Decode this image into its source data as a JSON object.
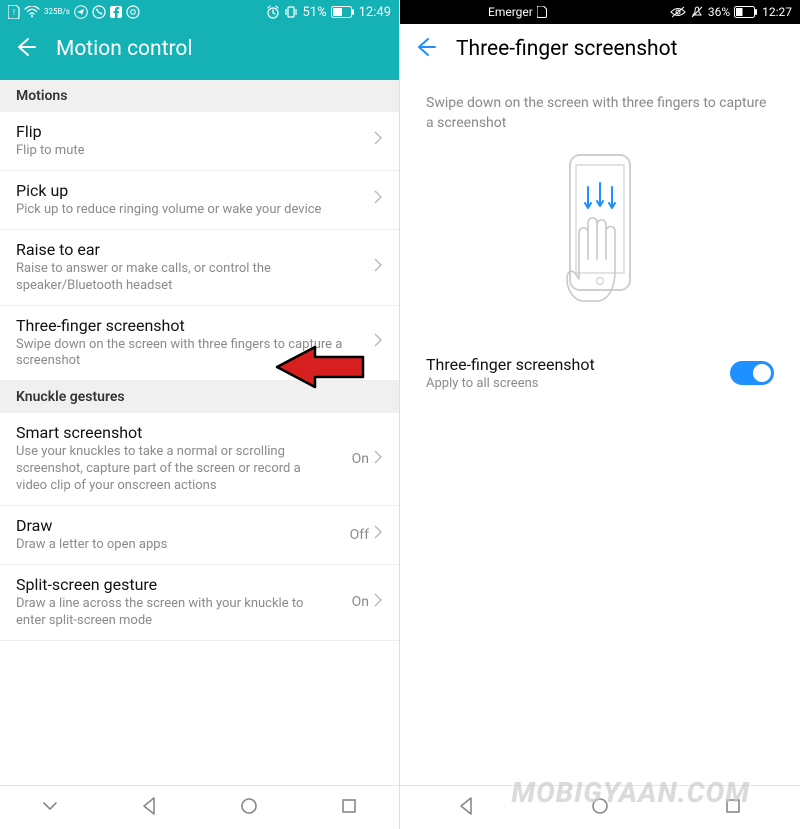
{
  "watermark": "MOBIGYAAN.COM",
  "left": {
    "statusbar": {
      "speed1": "325",
      "speed2": "B/s",
      "battery_pct": "51%",
      "time": "12:49"
    },
    "header": {
      "title": "Motion control"
    },
    "sections": {
      "motions": "Motions",
      "knuckle": "Knuckle gestures"
    },
    "rows": {
      "flip": {
        "title": "Flip",
        "subtitle": "Flip to mute"
      },
      "pickup": {
        "title": "Pick up",
        "subtitle": "Pick up to reduce ringing volume or wake your device"
      },
      "raise": {
        "title": "Raise to ear",
        "subtitle": "Raise to answer or make calls, or control the speaker/Bluetooth headset"
      },
      "tfs": {
        "title": "Three-finger screenshot",
        "subtitle": "Swipe down on the screen with three fingers to capture a screenshot"
      },
      "smart": {
        "title": "Smart screenshot",
        "subtitle": "Use your knuckles to take a normal or scrolling screenshot, capture part of the screen or record a video clip of your onscreen actions",
        "value": "On"
      },
      "draw": {
        "title": "Draw",
        "subtitle": "Draw a letter to open apps",
        "value": "Off"
      },
      "split": {
        "title": "Split-screen gesture",
        "subtitle": "Draw a line across the screen with your knuckle to enter split-screen mode",
        "value": "On"
      }
    }
  },
  "right": {
    "statusbar": {
      "carrier": "Emerger",
      "battery_pct": "36%",
      "time": "12:27"
    },
    "header": {
      "title": "Three-finger screenshot"
    },
    "instruction": "Swipe down on the screen with three fingers to capture a screenshot",
    "toggle": {
      "title": "Three-finger screenshot",
      "subtitle": "Apply to all screens",
      "state": "on"
    }
  }
}
